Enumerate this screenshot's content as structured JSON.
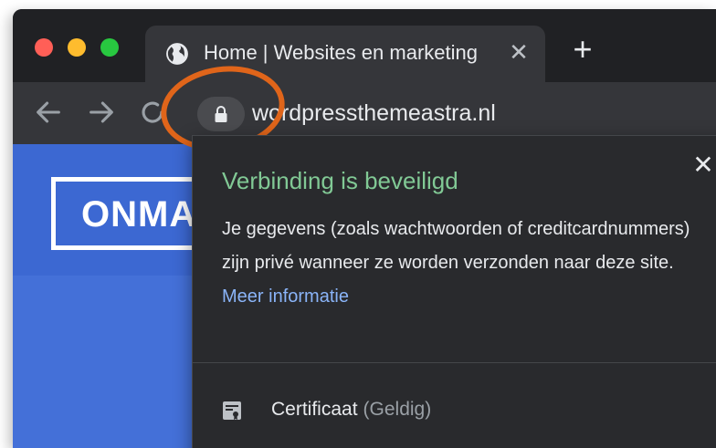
{
  "browser": {
    "tab": {
      "title": "Home | Websites en marketing",
      "close_glyph": "✕",
      "favicon": "globe-icon"
    },
    "new_tab_glyph": "+",
    "toolbar": {
      "back_icon": "arrow-left-icon",
      "forward_icon": "arrow-right-icon",
      "reload_icon": "reload-icon",
      "lock_icon": "lock-icon",
      "url": "wordpressthemeastra.nl"
    }
  },
  "page": {
    "logo_text": "ONMA"
  },
  "security_popup": {
    "close_glyph": "✕",
    "title": "Verbinding is beveiligd",
    "body": "Je gegevens (zoals wachtwoorden of creditcardnummers) zijn privé wanneer ze worden verzonden naar deze site.",
    "link": "Meer informatie",
    "certificate_label": "Certificaat",
    "certificate_status": "(Geldig)",
    "certificate_icon": "certificate-icon"
  },
  "colors": {
    "title_green": "#81c995",
    "link_blue": "#8ab4f8",
    "highlight_ring": "#e0651a"
  }
}
